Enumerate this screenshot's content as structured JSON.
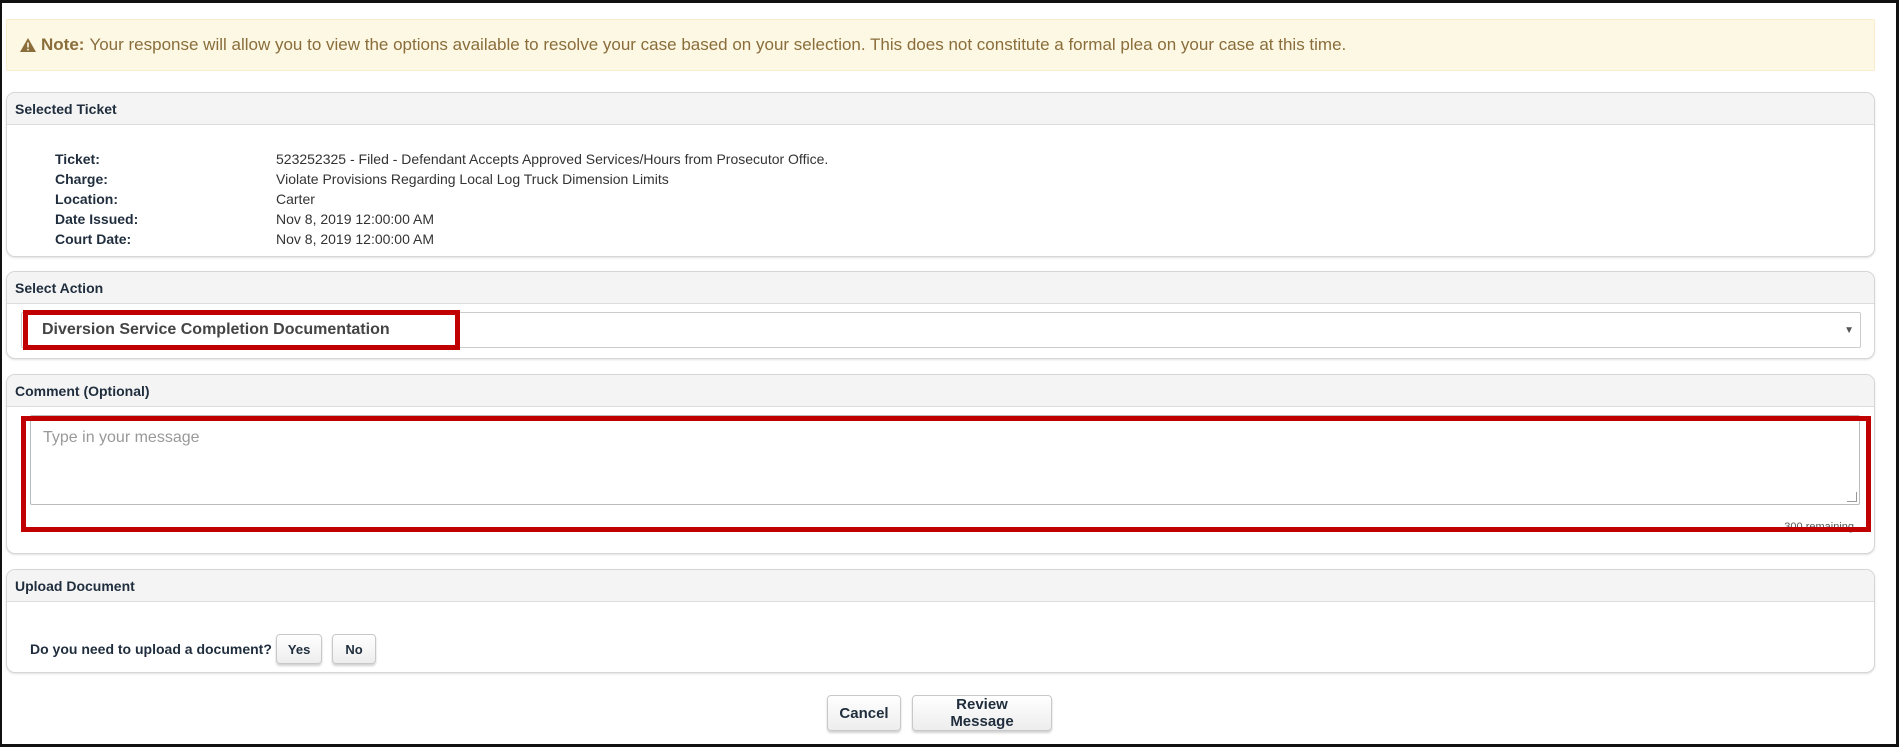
{
  "note": {
    "icon": "warning-icon",
    "label": "Note:",
    "text": "Your response will allow you to view the options available to resolve your case based on your selection. This does not constitute a formal plea on your case at this time."
  },
  "selected_ticket": {
    "heading": "Selected Ticket",
    "fields": [
      {
        "label": "Ticket:",
        "value": "523252325 - Filed - Defendant Accepts Approved Services/Hours from Prosecutor Office."
      },
      {
        "label": "Charge:",
        "value": "Violate Provisions Regarding Local Log Truck Dimension Limits"
      },
      {
        "label": "Location:",
        "value": "Carter"
      },
      {
        "label": "Date Issued:",
        "value": "Nov 8, 2019 12:00:00 AM"
      },
      {
        "label": "Court Date:",
        "value": "Nov 8, 2019 12:00:00 AM"
      }
    ]
  },
  "select_action": {
    "heading": "Select Action",
    "selected": "Diversion Service Completion Documentation",
    "caret": "▼"
  },
  "comment": {
    "heading": "Comment (Optional)",
    "placeholder": "Type in your message",
    "remaining": "300 remaining"
  },
  "upload": {
    "heading": "Upload Document",
    "question": "Do you need to upload a document?",
    "yes": "Yes",
    "no": "No"
  },
  "footer": {
    "cancel": "Cancel",
    "review": "Review Message"
  },
  "colors": {
    "highlight": "#c00000",
    "note_bg": "#fcf8e3",
    "note_text": "#8a6d3b"
  }
}
